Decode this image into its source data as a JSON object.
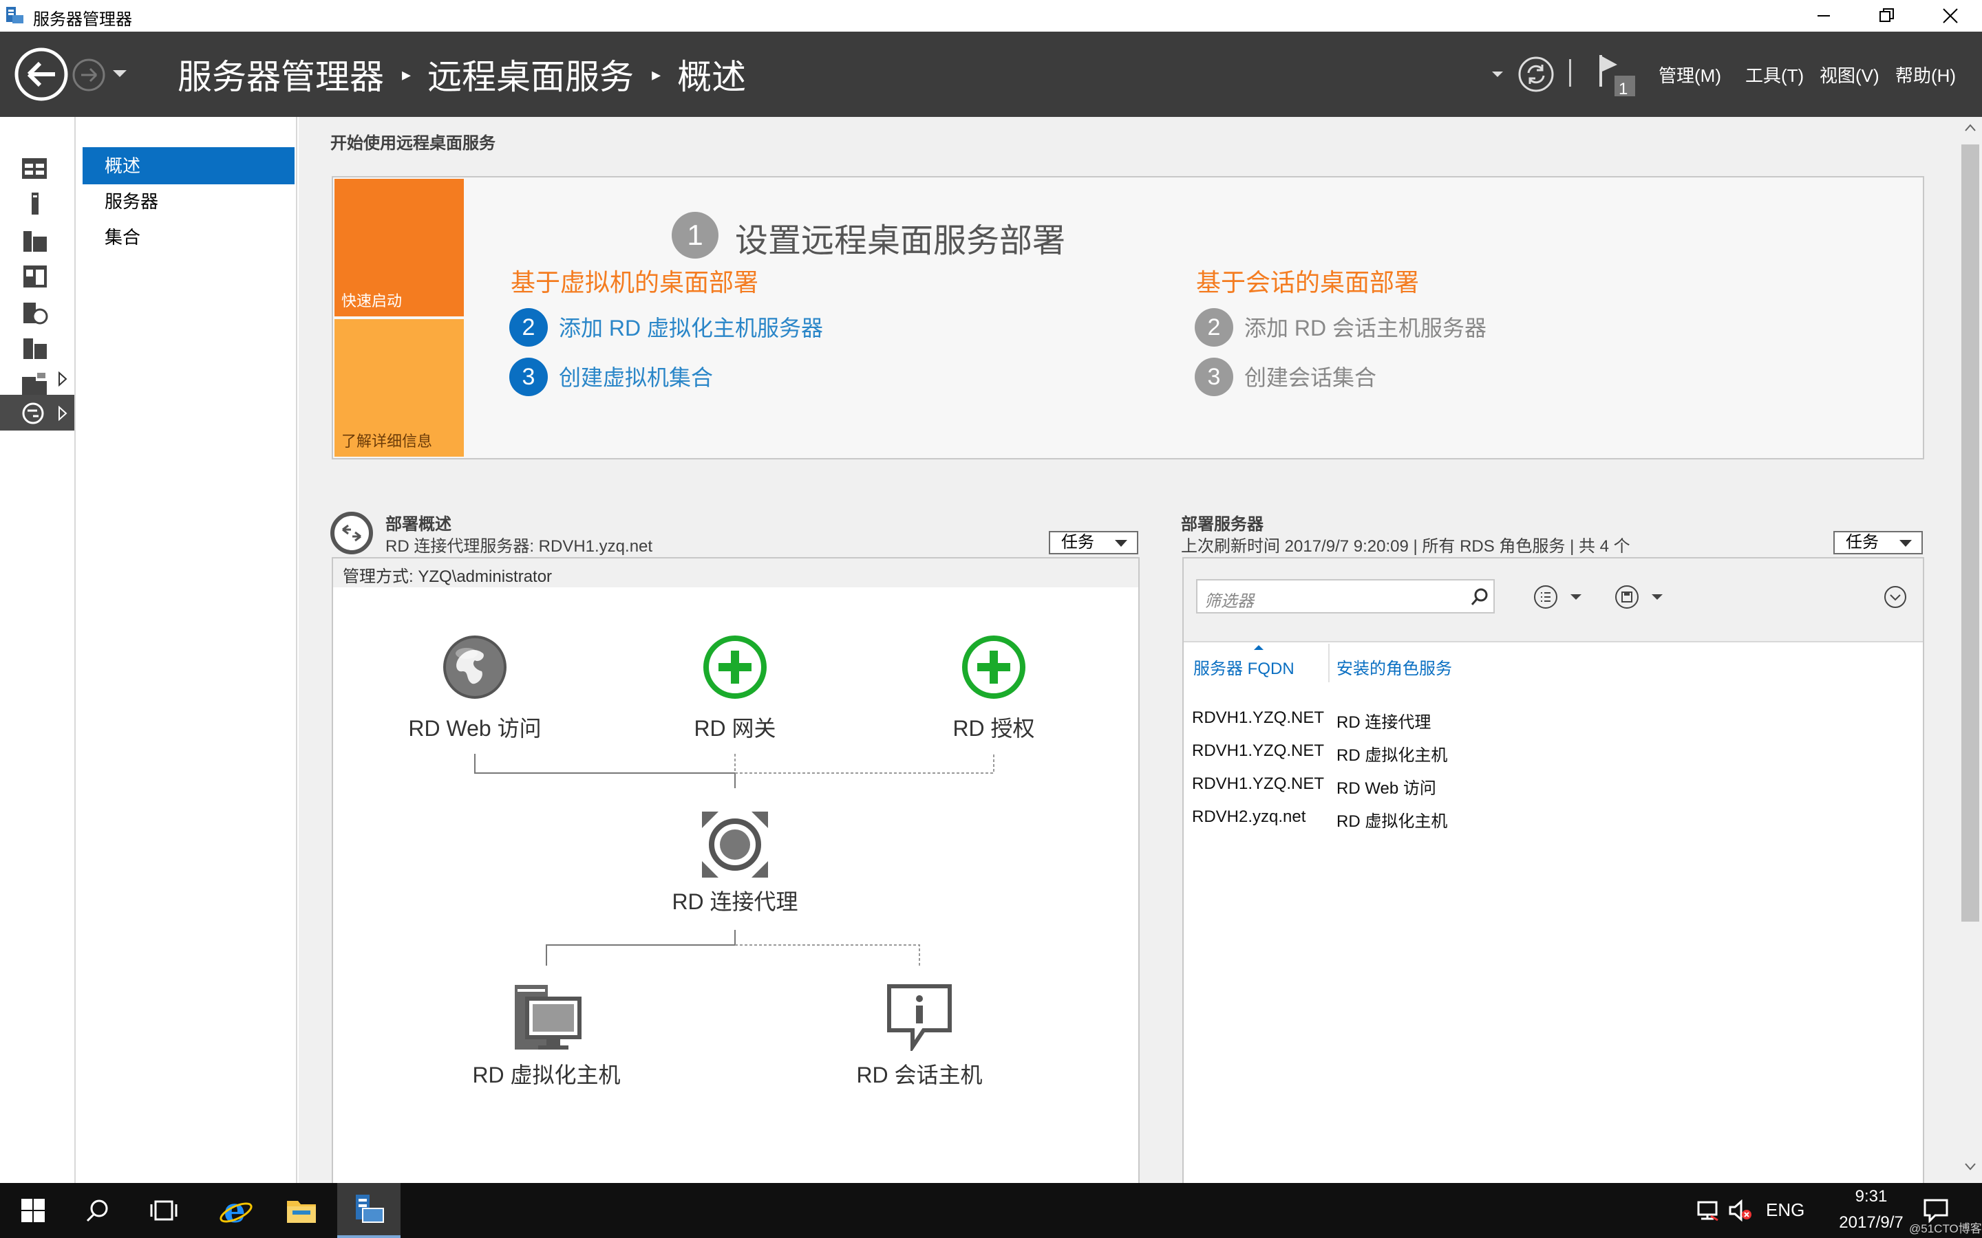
{
  "window": {
    "title": "服务器管理器"
  },
  "breadcrumb": [
    "服务器管理器",
    "远程桌面服务",
    "概述"
  ],
  "menu": {
    "manage": "管理(M)",
    "tools": "工具(T)",
    "view": "视图(V)",
    "help": "帮助(H)",
    "flag_count": "1"
  },
  "subnav": {
    "items": [
      "概述",
      "服务器",
      "集合"
    ]
  },
  "quickstart": {
    "section_title": "开始使用远程桌面服务",
    "tile_quick": "快速启动",
    "tile_learn": "了解详细信息",
    "step1_num": "1",
    "step1": "设置远程桌面服务部署",
    "vm_title": "基于虚拟机的桌面部署",
    "vm_steps": [
      {
        "num": "2",
        "label": "添加 RD 虚拟化主机服务器"
      },
      {
        "num": "3",
        "label": "创建虚拟机集合"
      }
    ],
    "session_title": "基于会话的桌面部署",
    "session_steps": [
      {
        "num": "2",
        "label": "添加 RD 会话主机服务器"
      },
      {
        "num": "3",
        "label": "创建会话集合"
      }
    ]
  },
  "overview": {
    "title": "部署概述",
    "subtitle": "RD 连接代理服务器: RDVH1.yzq.net",
    "task": "任务",
    "managed_by": "管理方式: YZQ\\administrator",
    "roles": {
      "web": "RD Web 访问",
      "gateway": "RD 网关",
      "license": "RD 授权",
      "broker": "RD 连接代理",
      "virt": "RD 虚拟化主机",
      "session": "RD 会话主机"
    }
  },
  "servers": {
    "title": "部署服务器",
    "subtitle": "上次刷新时间 2017/9/7 9:20:09 | 所有 RDS 角色服务 | 共 4 个",
    "task": "任务",
    "filter_placeholder": "筛选器",
    "col_fqdn": "服务器 FQDN",
    "col_role": "安装的角色服务",
    "rows": [
      [
        "RDVH1.YZQ.NET",
        "RD 连接代理"
      ],
      [
        "RDVH1.YZQ.NET",
        "RD 虚拟化主机"
      ],
      [
        "RDVH1.YZQ.NET",
        "RD Web 访问"
      ],
      [
        "RDVH2.yzq.net",
        "RD 虚拟化主机"
      ]
    ]
  },
  "taskbar": {
    "lang": "ENG",
    "time": "9:31",
    "date": "2017/9/7",
    "watermark": "@51CTO博客"
  },
  "colors": {
    "header": "#3c3c3c",
    "accent": "#0a6fc2",
    "orange": "#f47c20",
    "orange_light": "#fbaa3f",
    "green": "#1aab2b"
  }
}
